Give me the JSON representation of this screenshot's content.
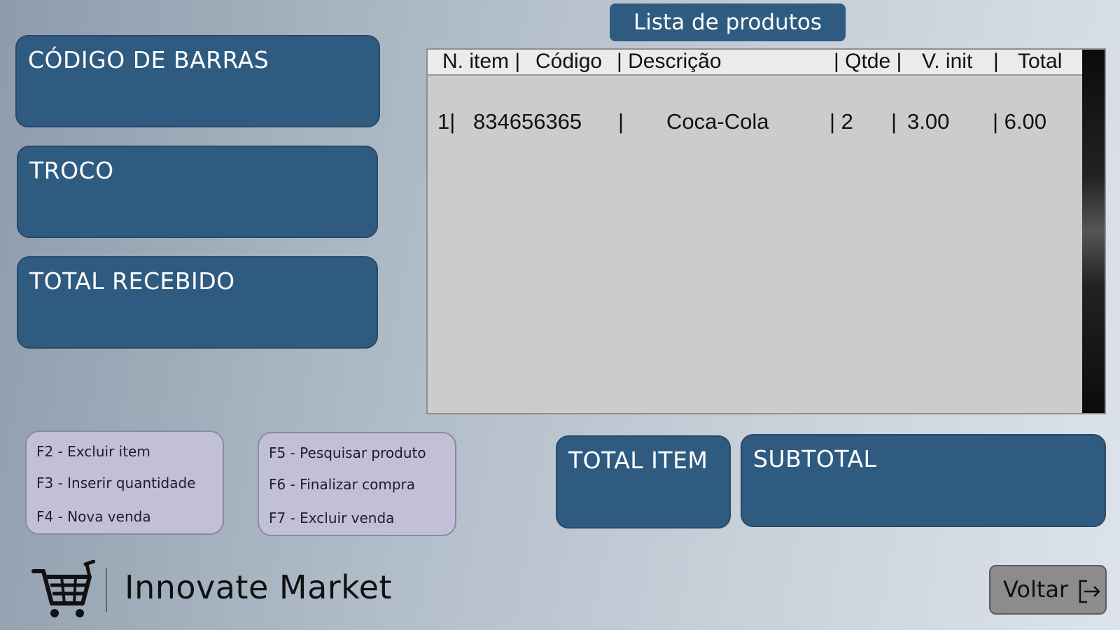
{
  "left_fields": {
    "barcode": {
      "label": "CÓDIGO DE BARRAS",
      "value": ""
    },
    "change": {
      "label": "TROCO",
      "value": ""
    },
    "total_received": {
      "label": "TOTAL RECEBIDO",
      "value": ""
    }
  },
  "product_list": {
    "title": "Lista de produtos",
    "headers": {
      "item": "N. item |",
      "code": "Código",
      "description": "| Descrição",
      "qty": "| Qtde |",
      "unit": "V. init",
      "unit_sep": "|",
      "total": "Total"
    },
    "rows": [
      {
        "item": "1|",
        "code": "834656365",
        "sep1": "|",
        "description": "Coca-Cola",
        "qty": "| 2",
        "sep2": "|",
        "unit": "3.00",
        "total": "| 6.00"
      }
    ]
  },
  "shortcuts": {
    "group1": [
      "F2 - Excluir item",
      "F3 - Inserir quantidade",
      "F4 - Nova venda"
    ],
    "group2": [
      "F5 - Pesquisar produto",
      "F6 - Finalizar compra",
      "F7 - Excluir venda"
    ]
  },
  "totals": {
    "total_item": {
      "label": "TOTAL ITEM",
      "value": ""
    },
    "subtotal": {
      "label": "SUBTOTAL",
      "value": ""
    }
  },
  "brand": {
    "name": "Innovate Market",
    "icon": "shopping-cart-icon"
  },
  "back_button": {
    "label": "Voltar",
    "icon": "exit-icon"
  },
  "colors": {
    "panel": "#2f5b80",
    "shortcut_box": "#c2c0d6",
    "list_background": "#cccccc",
    "button": "#8c8c8c"
  }
}
